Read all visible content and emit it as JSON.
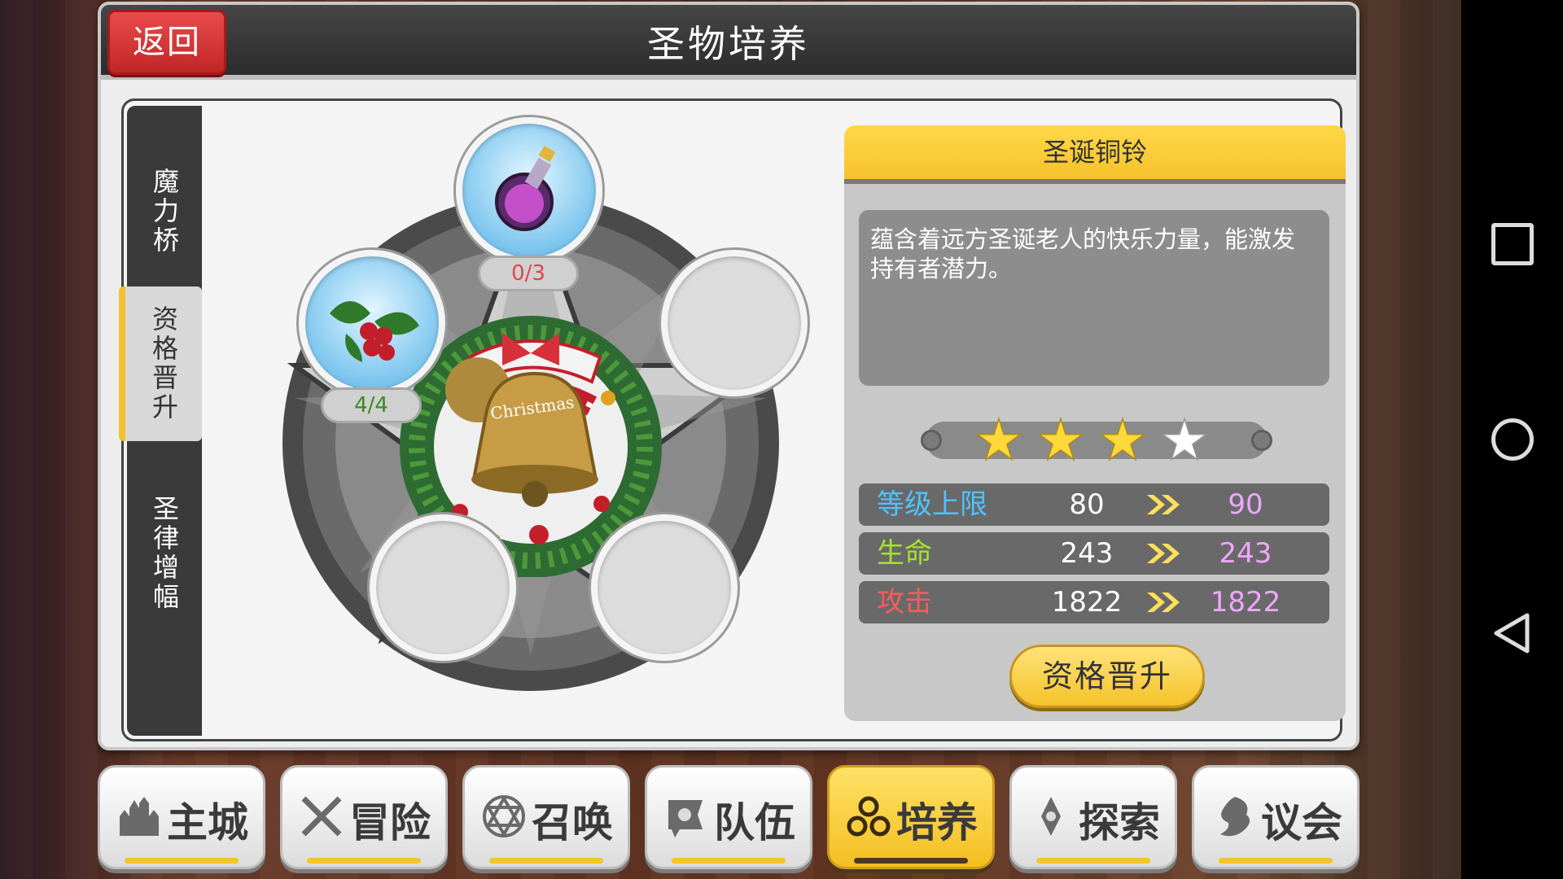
{
  "header": {
    "title": "圣物培养",
    "back_label": "返回"
  },
  "side_tabs": [
    {
      "label": "魔力桥",
      "active": false
    },
    {
      "label": "资格晋升",
      "active": true
    },
    {
      "label": "圣律增幅",
      "active": false
    }
  ],
  "slots": [
    {
      "position": "top",
      "item": "potion-bottle-icon",
      "count": "0/3",
      "count_color": "#e0454b"
    },
    {
      "position": "left",
      "item": "holly-berries-icon",
      "count": "4/4",
      "count_color": "#3c8a1f"
    },
    {
      "position": "right",
      "item": "",
      "count": ""
    },
    {
      "position": "bottom-left",
      "item": "",
      "count": ""
    },
    {
      "position": "bottom-right",
      "item": "",
      "count": ""
    }
  ],
  "center_item": {
    "icon": "christmas-bell-wreath-icon",
    "ribbon_text": "Christmas"
  },
  "relic": {
    "name": "圣诞铜铃",
    "description": "蕴含着远方圣诞老人的快乐力量，能激发持有者潜力。",
    "stars_filled": 3,
    "stars_total": 4
  },
  "stats": [
    {
      "label": "等级上限",
      "label_color": "#4fc3ff",
      "current": "80",
      "next": "90"
    },
    {
      "label": "生命",
      "label_color": "#a6e22e",
      "current": "243",
      "next": "243"
    },
    {
      "label": "攻击",
      "label_color": "#ff5a5a",
      "current": "1822",
      "next": "1822"
    }
  ],
  "upgrade_button": "资格晋升",
  "bottom_nav": [
    {
      "label": "主城",
      "icon": "castle-icon",
      "active": false
    },
    {
      "label": "冒险",
      "icon": "crossed-swords-icon",
      "active": false
    },
    {
      "label": "召唤",
      "icon": "hexagram-icon",
      "active": false
    },
    {
      "label": "队伍",
      "icon": "team-flag-icon",
      "active": false
    },
    {
      "label": "培养",
      "icon": "triple-circles-icon",
      "active": true
    },
    {
      "label": "探索",
      "icon": "compass-pin-icon",
      "active": false
    },
    {
      "label": "议会",
      "icon": "dragon-crest-icon",
      "active": false
    }
  ],
  "colors": {
    "accent": "#f5c22b",
    "back_button": "#d33131",
    "stat_new": "#f0a6ff"
  }
}
